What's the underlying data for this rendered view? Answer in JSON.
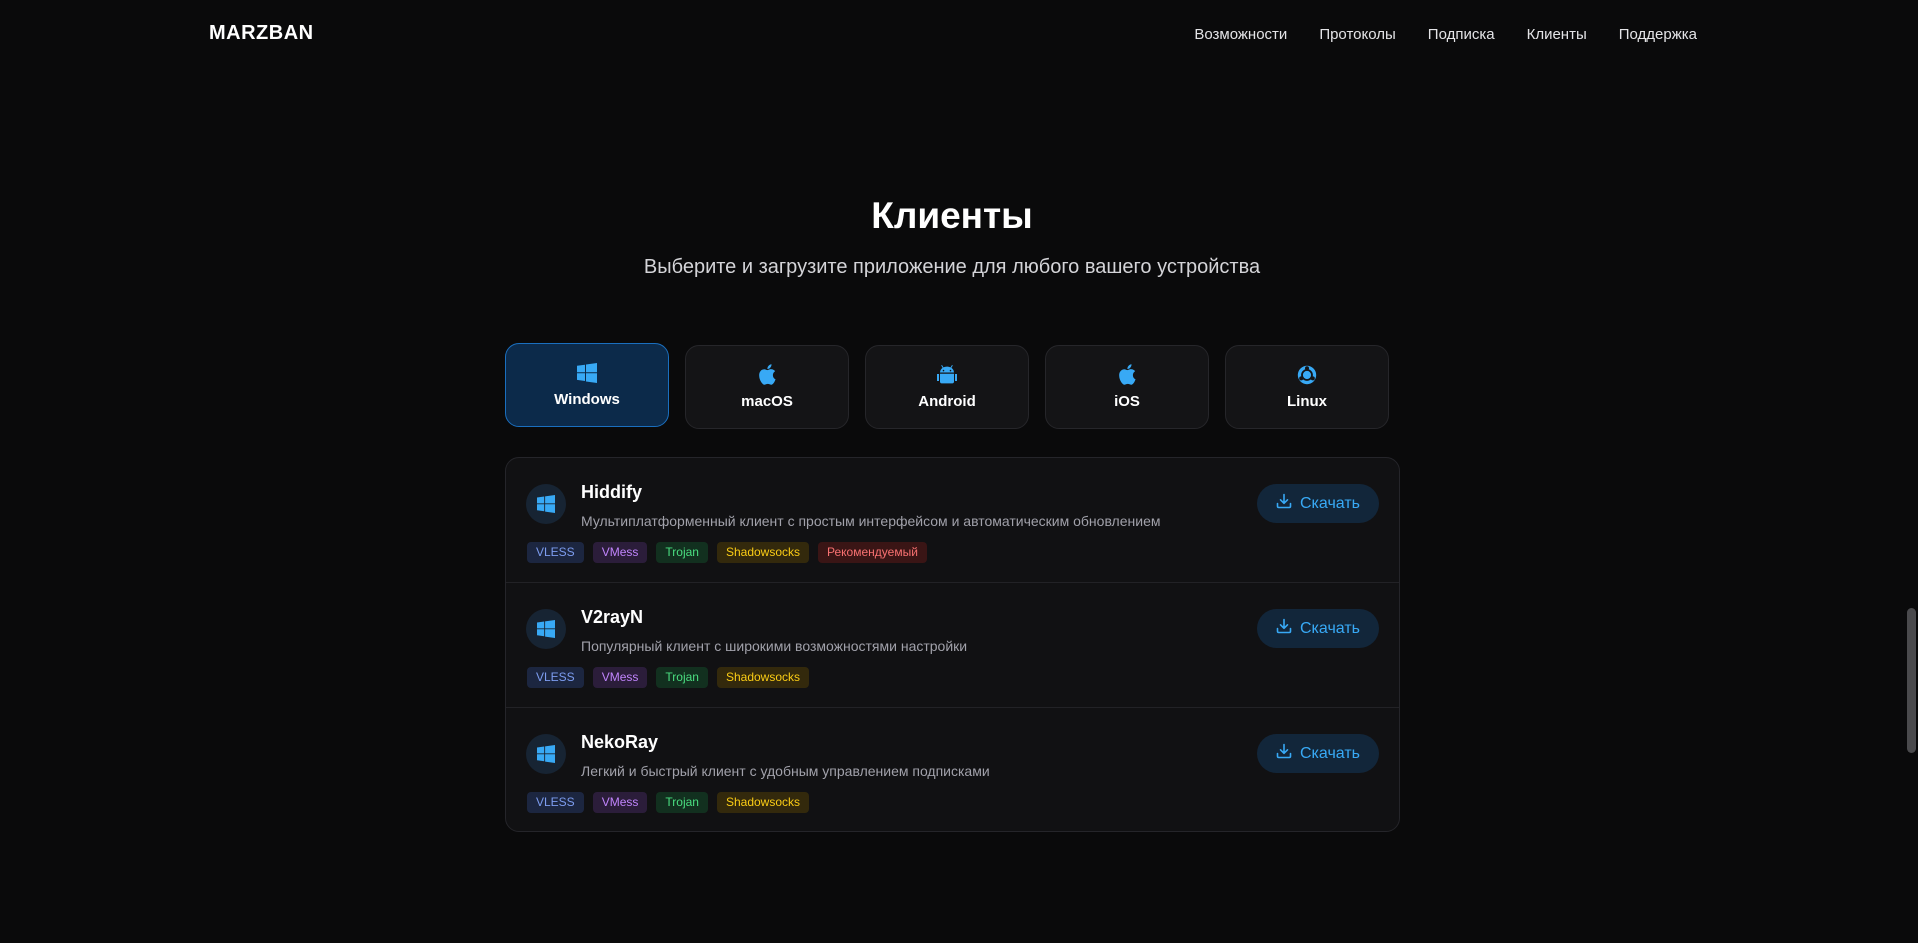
{
  "header": {
    "logo": "MARZBAN",
    "nav": [
      "Возможности",
      "Протоколы",
      "Подписка",
      "Клиенты",
      "Поддержка"
    ]
  },
  "section": {
    "title": "Клиенты",
    "subtitle": "Выберите и загрузите приложение для любого вашего устройства"
  },
  "tabs": [
    {
      "label": "Windows",
      "icon": "windows-icon",
      "active": true
    },
    {
      "label": "macOS",
      "icon": "apple-icon",
      "active": false
    },
    {
      "label": "Android",
      "icon": "android-icon",
      "active": false
    },
    {
      "label": "iOS",
      "icon": "apple-icon",
      "active": false
    },
    {
      "label": "Linux",
      "icon": "linux-icon",
      "active": false
    }
  ],
  "clients": [
    {
      "name": "Hiddify",
      "description": "Мультиплатформенный клиент с простым интерфейсом и автоматическим обновлением",
      "tags": [
        "VLESS",
        "VMess",
        "Trojan",
        "Shadowsocks",
        "Рекомендуемый"
      ],
      "download_label": "Скачать"
    },
    {
      "name": "V2rayN",
      "description": "Популярный клиент с широкими возможностями настройки",
      "tags": [
        "VLESS",
        "VMess",
        "Trojan",
        "Shadowsocks"
      ],
      "download_label": "Скачать"
    },
    {
      "name": "NekoRay",
      "description": "Легкий и быстрый клиент с удобным управлением подписками",
      "tags": [
        "VLESS",
        "VMess",
        "Trojan",
        "Shadowsocks"
      ],
      "download_label": "Скачать"
    }
  ],
  "colors": {
    "accent": "#38a9f5",
    "background": "#0a0a0b",
    "active_tab_bg": "#0c2a4a",
    "active_tab_border": "#1a6fbf"
  }
}
